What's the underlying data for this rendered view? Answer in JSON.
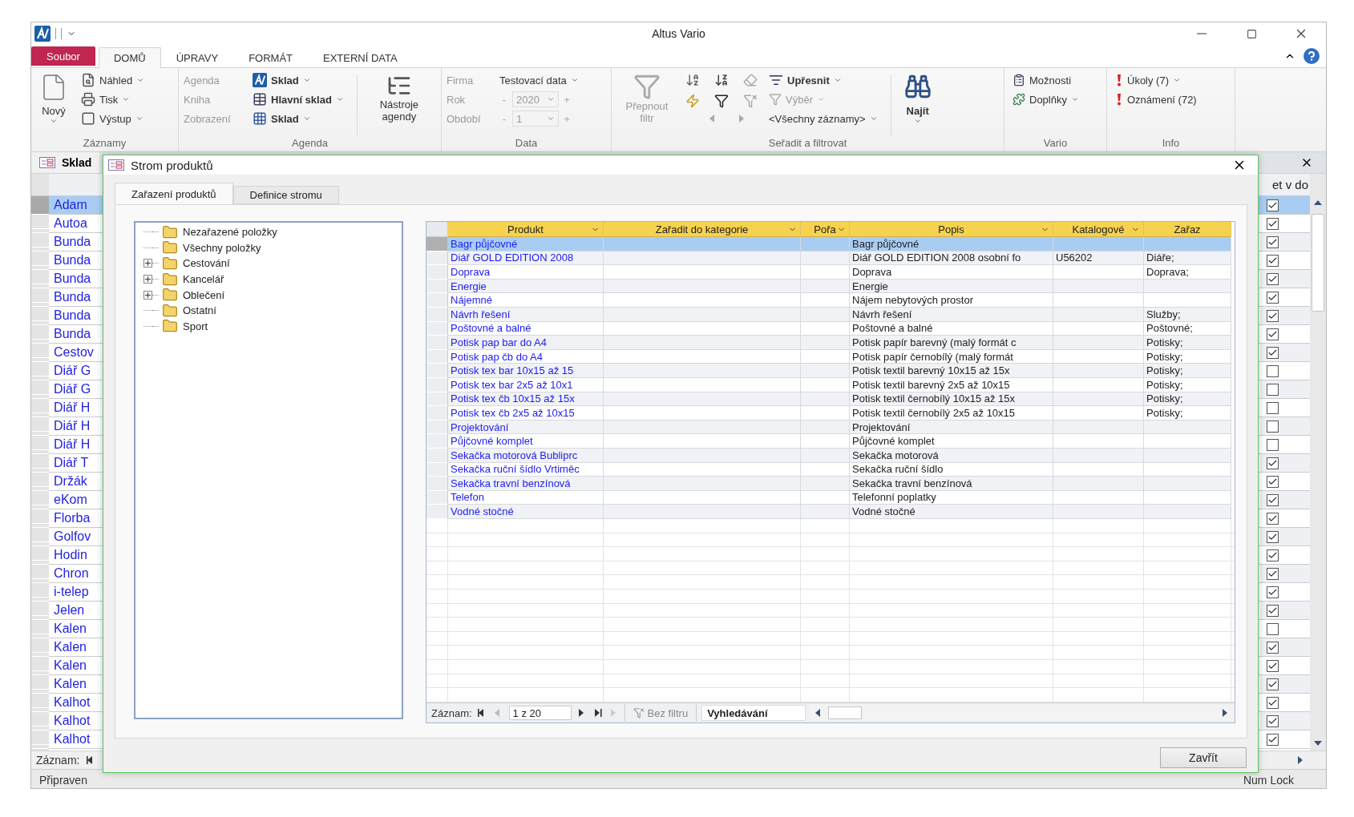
{
  "window": {
    "title": "Altus Vario"
  },
  "ribbon_tabs": [
    {
      "label": "Soubor",
      "kind": "file",
      "selected": false
    },
    {
      "label": "DOMŮ",
      "kind": "tab",
      "selected": true
    },
    {
      "label": "ÚPRAVY",
      "kind": "tab",
      "selected": false
    },
    {
      "label": "FORMÁT",
      "kind": "tab",
      "selected": false
    },
    {
      "label": "EXTERNÍ DATA",
      "kind": "tab",
      "selected": false
    }
  ],
  "ribbon": {
    "records": {
      "label": "Záznamy",
      "new": "Nový",
      "buttons": [
        "Náhled",
        "Tisk",
        "Výstup"
      ]
    },
    "agenda": {
      "label": "Agenda",
      "rows": [
        {
          "label": "Agenda",
          "value": "Sklad"
        },
        {
          "label": "Kniha",
          "value": "Hlavní sklad"
        },
        {
          "label": "Zobrazení",
          "value": "Sklad"
        }
      ],
      "tools": "Nástroje agendy"
    },
    "data": {
      "label": "Data",
      "company": {
        "label": "Firma",
        "value": "Testovací data"
      },
      "year": {
        "label": "Rok",
        "value": "2020",
        "minus": "-",
        "plus": "+"
      },
      "period": {
        "label": "Období",
        "value": "1",
        "minus": "-",
        "plus": "+"
      }
    },
    "filter": {
      "label": "Seřadit a filtrovat",
      "toggle": {
        "label": "Přepnout filtr",
        "disabled": true
      },
      "refine": "Upřesnit",
      "selection": {
        "label": "Výběr",
        "disabled": true
      },
      "records": "<Všechny záznamy>",
      "find": "Najít"
    },
    "vario": {
      "label": "Vario",
      "buttons": [
        "Možnosti",
        "Doplňky"
      ]
    },
    "info": {
      "label": "Info",
      "buttons": [
        "Úkoly (7)",
        "Oznámení (72)"
      ]
    }
  },
  "sklad": {
    "tab": "Sklad",
    "column": "et v do",
    "nav_label": "Záznam:",
    "rows": [
      {
        "name": "Adam",
        "checked": true,
        "selected": true
      },
      {
        "name": "Autoa",
        "checked": true,
        "selected": false
      },
      {
        "name": "Bunda",
        "checked": true,
        "selected": false
      },
      {
        "name": "Bunda",
        "checked": true,
        "selected": false
      },
      {
        "name": "Bunda",
        "checked": true,
        "selected": false
      },
      {
        "name": "Bunda",
        "checked": true,
        "selected": false
      },
      {
        "name": "Bunda",
        "checked": true,
        "selected": false
      },
      {
        "name": "Bunda",
        "checked": true,
        "selected": false
      },
      {
        "name": "Cestov",
        "checked": true,
        "selected": false
      },
      {
        "name": "Diář G",
        "checked": false,
        "selected": false
      },
      {
        "name": "Diář G",
        "checked": false,
        "selected": false
      },
      {
        "name": "Diář H",
        "checked": false,
        "selected": false
      },
      {
        "name": "Diář H",
        "checked": false,
        "selected": false
      },
      {
        "name": "Diář H",
        "checked": false,
        "selected": false
      },
      {
        "name": "Diář T",
        "checked": true,
        "selected": false
      },
      {
        "name": "Držák",
        "checked": true,
        "selected": false
      },
      {
        "name": "eKom",
        "checked": true,
        "selected": false
      },
      {
        "name": "Florba",
        "checked": true,
        "selected": false
      },
      {
        "name": "Golfov",
        "checked": true,
        "selected": false
      },
      {
        "name": "Hodin",
        "checked": true,
        "selected": false
      },
      {
        "name": "Chron",
        "checked": true,
        "selected": false
      },
      {
        "name": "i-telep",
        "checked": true,
        "selected": false
      },
      {
        "name": "Jelen",
        "checked": true,
        "selected": false
      },
      {
        "name": "Kalen",
        "checked": false,
        "selected": false
      },
      {
        "name": "Kalen",
        "checked": true,
        "selected": false
      },
      {
        "name": "Kalen",
        "checked": true,
        "selected": false
      },
      {
        "name": "Kalen",
        "checked": true,
        "selected": false
      },
      {
        "name": "Kalhot",
        "checked": true,
        "selected": false
      },
      {
        "name": "Kalhot",
        "checked": true,
        "selected": false
      },
      {
        "name": "Kalhot",
        "checked": true,
        "selected": false
      }
    ]
  },
  "status_bar": {
    "left": "Připraven",
    "right": "Num Lock"
  },
  "dialog": {
    "title": "Strom produktů",
    "tabs": [
      {
        "label": "Zařazení produktů",
        "selected": true
      },
      {
        "label": "Definice stromu",
        "selected": false
      }
    ],
    "tree": [
      {
        "label": "Nezařazené položky"
      },
      {
        "label": "Všechny položky"
      },
      {
        "label": "Cestování",
        "expanded": false
      },
      {
        "label": "Kancelář",
        "expanded": false
      },
      {
        "label": "Oblečení",
        "expanded": false
      },
      {
        "label": "Ostatní"
      },
      {
        "label": "Sport"
      }
    ],
    "columns": [
      {
        "label": "Produkt",
        "menu": true
      },
      {
        "label": "Zařadit do kategorie",
        "menu": true
      },
      {
        "label": "Pořa",
        "menu": true
      },
      {
        "label": "Popis",
        "menu": true
      },
      {
        "label": "Katalogové",
        "menu": true
      },
      {
        "label": "Zařaz",
        "menu": false
      }
    ],
    "rows": [
      {
        "product": "Bagr půjčovné",
        "description": "Bagr půjčovné",
        "selected": true
      },
      {
        "product": "Diář GOLD EDITION 2008",
        "description": "Diář GOLD EDITION 2008 osobní fo",
        "catalog": "U56202",
        "category": "Diáře;",
        "selected": false
      },
      {
        "product": "Doprava",
        "description": "Doprava",
        "category": "Doprava;",
        "selected": false
      },
      {
        "product": "Energie",
        "description": "Energie",
        "selected": false
      },
      {
        "product": "Nájemné",
        "description": "Nájem nebytových prostor",
        "selected": false
      },
      {
        "product": "Návrh řešení",
        "description": "Návrh řešení",
        "category": "Služby;",
        "selected": false
      },
      {
        "product": "Poštovné a balné",
        "description": "Poštovné a balné",
        "category": "Poštovné;",
        "selected": false
      },
      {
        "product": "Potisk pap bar do A4",
        "description": "Potisk papír barevný (malý formát c",
        "category": "Potisky;",
        "selected": false
      },
      {
        "product": "Potisk pap čb do A4",
        "description": "Potisk papír černobílý (malý formát",
        "category": "Potisky;",
        "selected": false
      },
      {
        "product": "Potisk tex bar 10x15 až 15",
        "description": "Potisk textil barevný 10x15 až 15x",
        "category": "Potisky;",
        "selected": false
      },
      {
        "product": "Potisk tex bar 2x5 až 10x1",
        "description": "Potisk textil barevný 2x5 až 10x15",
        "category": "Potisky;",
        "selected": false
      },
      {
        "product": "Potisk tex čb 10x15 až 15x",
        "description": "Potisk textil černobílý 10x15 až 15x",
        "category": "Potisky;",
        "selected": false
      },
      {
        "product": "Potisk tex čb 2x5 až 10x15",
        "description": "Potisk textil černobílý 2x5 až 10x15",
        "category": "Potisky;",
        "selected": false
      },
      {
        "product": "Projektování",
        "description": "Projektování",
        "selected": false
      },
      {
        "product": "Půjčovné komplet",
        "description": "Půjčovné komplet",
        "selected": false
      },
      {
        "product": "Sekačka motorová Bubliprc",
        "description": "Sekačka motorová",
        "selected": false
      },
      {
        "product": "Sekačka ruční šídlo Vrtiměc",
        "description": "Sekačka ruční šídlo",
        "selected": false
      },
      {
        "product": "Sekačka travní benzínová",
        "description": "Sekačka travní benzínová",
        "selected": false
      },
      {
        "product": "Telefon",
        "description": "Telefonní poplatky",
        "selected": false
      },
      {
        "product": "Vodné stočné",
        "description": "Vodné stočné",
        "selected": false
      }
    ],
    "nav": {
      "label": "Záznam:",
      "position": "1 z 20",
      "filter": "Bez filtru",
      "placeholder": "Vyhledávání"
    },
    "close": "Zavřít"
  }
}
